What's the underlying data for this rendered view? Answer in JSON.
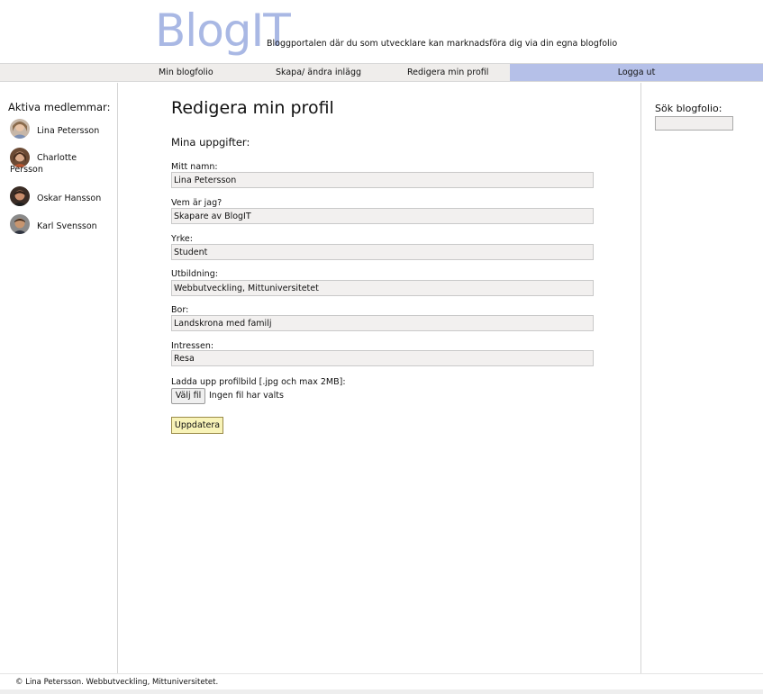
{
  "header": {
    "logo": "BlogIT",
    "tagline": "Bloggportalen där du som utvecklare kan marknadsföra dig via din egna blogfolio"
  },
  "nav": {
    "items": [
      {
        "label": "Min blogfolio"
      },
      {
        "label": "Skapa/ ändra inlägg"
      },
      {
        "label": "Redigera min profil"
      }
    ],
    "logout": "Logga ut",
    "logout_color": "#b5c0e8"
  },
  "sidebar": {
    "title": "Aktiva medlemmar:",
    "members": [
      {
        "name": "Lina Petersson",
        "icon": "avatar-photo"
      },
      {
        "name": "Charlotte Persson",
        "icon": "avatar-photo"
      },
      {
        "name": "Oskar Hansson",
        "icon": "avatar-photo"
      },
      {
        "name": "Karl Svensson",
        "icon": "avatar-photo"
      }
    ]
  },
  "search": {
    "label": "Sök blogfolio:",
    "value": ""
  },
  "main": {
    "title": "Redigera min profil",
    "section": "Mina uppgifter:",
    "fields": [
      {
        "label": "Mitt namn:",
        "value": "Lina Petersson"
      },
      {
        "label": "Vem är jag?",
        "value": "Skapare av BlogIT"
      },
      {
        "label": "Yrke:",
        "value": "Student"
      },
      {
        "label": "Utbildning:",
        "value": "Webbutveckling, Mittuniversitetet"
      },
      {
        "label": "Bor:",
        "value": "Landskrona med familj"
      },
      {
        "label": "Intressen:",
        "value": "Resa"
      }
    ],
    "upload_label": "Ladda upp profilbild [.jpg och max 2MB]:",
    "file_button": "Välj fil",
    "file_status": "Ingen fil har valts",
    "submit": "Uppdatera",
    "submit_color": "#f8f3b8"
  },
  "footer": {
    "text": "© Lina Petersson. Webbutveckling, Mittuniversitetet."
  },
  "colors": {
    "logo": "#a9b8e4",
    "navbar": "#efedeb"
  }
}
